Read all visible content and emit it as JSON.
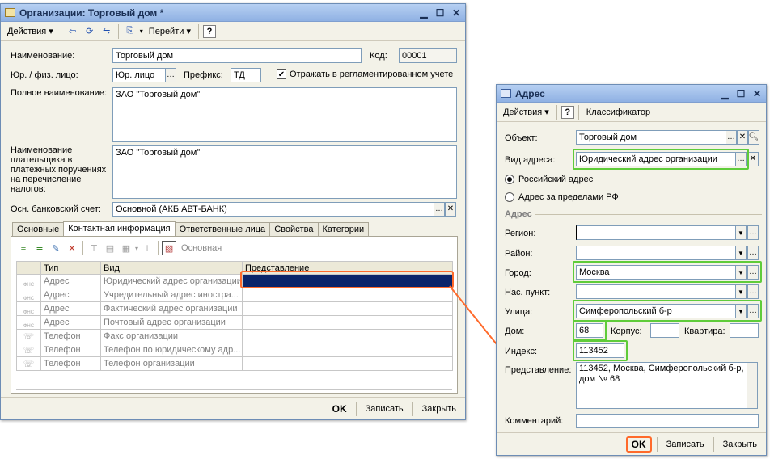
{
  "colors": {
    "highlight_green": "#5fcc3a",
    "highlight_orange": "#ff6a2b",
    "selection": "#0a246a"
  },
  "org_window": {
    "title": "Организации: Торговый дом *",
    "toolbar": {
      "actions": "Действия",
      "goto": "Перейти",
      "help": "?"
    },
    "fields": {
      "name_label": "Наименование:",
      "name_value": "Торговый дом",
      "code_label": "Код:",
      "code_value": "00001",
      "legal_label": "Юр. / физ. лицо:",
      "legal_value": "Юр. лицо",
      "prefix_label": "Префикс:",
      "prefix_value": "ТД",
      "reglament_label": "Отражать в регламентированном учете",
      "reglament_checked": true,
      "fullname_label": "Полное наименование:",
      "fullname_value": "ЗАО \"Торговый дом\"",
      "payer_label": "Наименование плательщика в платежных поручениях на перечисление налогов:",
      "payer_value": "ЗАО \"Торговый дом\"",
      "bank_label": "Осн. банковский счет:",
      "bank_value": "Основной (АКБ АВТ-БАНК)"
    },
    "tabs": [
      "Основные",
      "Контактная информация",
      "Ответственные лица",
      "Свойства",
      "Категории"
    ],
    "active_tab": 1,
    "contacts_toolbar": {
      "main_label": "Основная"
    },
    "table": {
      "headers": [
        "Тип",
        "Вид",
        "Представление"
      ],
      "rows": [
        {
          "type": "Адрес",
          "kind": "Юридический адрес организации",
          "view": "",
          "icon": "fias-address-icon"
        },
        {
          "type": "Адрес",
          "kind": "Учредительный адрес иностра...",
          "view": "",
          "icon": "fias-address-icon"
        },
        {
          "type": "Адрес",
          "kind": "Фактический адрес организации",
          "view": "",
          "icon": "fias-address-icon"
        },
        {
          "type": "Адрес",
          "kind": "Почтовый адрес организации",
          "view": "",
          "icon": "fias-address-icon"
        },
        {
          "type": "Телефон",
          "kind": "Факс организации",
          "view": "",
          "icon": "phone-icon"
        },
        {
          "type": "Телефон",
          "kind": "Телефон по юридическому адр...",
          "view": "",
          "icon": "phone-icon"
        },
        {
          "type": "Телефон",
          "kind": "Телефон организации",
          "view": "",
          "icon": "phone-icon"
        }
      ]
    },
    "icon_caption": "ФНС",
    "bottom": {
      "ok": "OK",
      "save": "Записать",
      "close": "Закрыть"
    }
  },
  "addr_window": {
    "title": "Адрес",
    "toolbar": {
      "actions": "Действия",
      "help": "?",
      "classifier": "Классификатор"
    },
    "object_label": "Объект:",
    "object_value": "Торговый дом",
    "kind_label": "Вид адреса:",
    "kind_value": "Юридический адрес организации",
    "radio_ru": "Российский адрес",
    "radio_foreign": "Адрес за пределами РФ",
    "radio_selected": "ru",
    "section_title": "Адрес",
    "region_label": "Регион:",
    "region_value": "",
    "district_label": "Район:",
    "district_value": "",
    "city_label": "Город:",
    "city_value": "Москва",
    "settlement_label": "Нас. пункт:",
    "settlement_value": "",
    "street_label": "Улица:",
    "street_value": "Симферопольский б-р",
    "house_label": "Дом:",
    "house_value": "68",
    "korpus_label": "Корпус:",
    "korpus_value": "",
    "flat_label": "Квартира:",
    "flat_value": "",
    "index_label": "Индекс:",
    "index_value": "113452",
    "view_label": "Представление:",
    "view_value": "113452, Москва, Симферопольский б-р, дом № 68",
    "comment_label": "Комментарий:",
    "comment_value": "",
    "bottom": {
      "ok": "OK",
      "save": "Записать",
      "close": "Закрыть"
    }
  }
}
